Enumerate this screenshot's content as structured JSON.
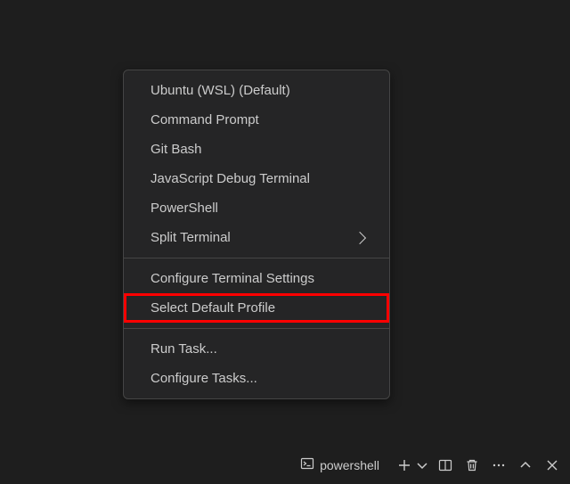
{
  "menu": {
    "items": {
      "ubuntu_wsl": "Ubuntu (WSL) (Default)",
      "command_prompt": "Command Prompt",
      "git_bash": "Git Bash",
      "js_debug": "JavaScript Debug Terminal",
      "powershell": "PowerShell",
      "split_terminal": "Split Terminal",
      "configure_settings": "Configure Terminal Settings",
      "select_default_profile": "Select Default Profile",
      "run_task": "Run Task...",
      "configure_tasks": "Configure Tasks..."
    }
  },
  "bottom_bar": {
    "terminal_label": "powershell"
  }
}
